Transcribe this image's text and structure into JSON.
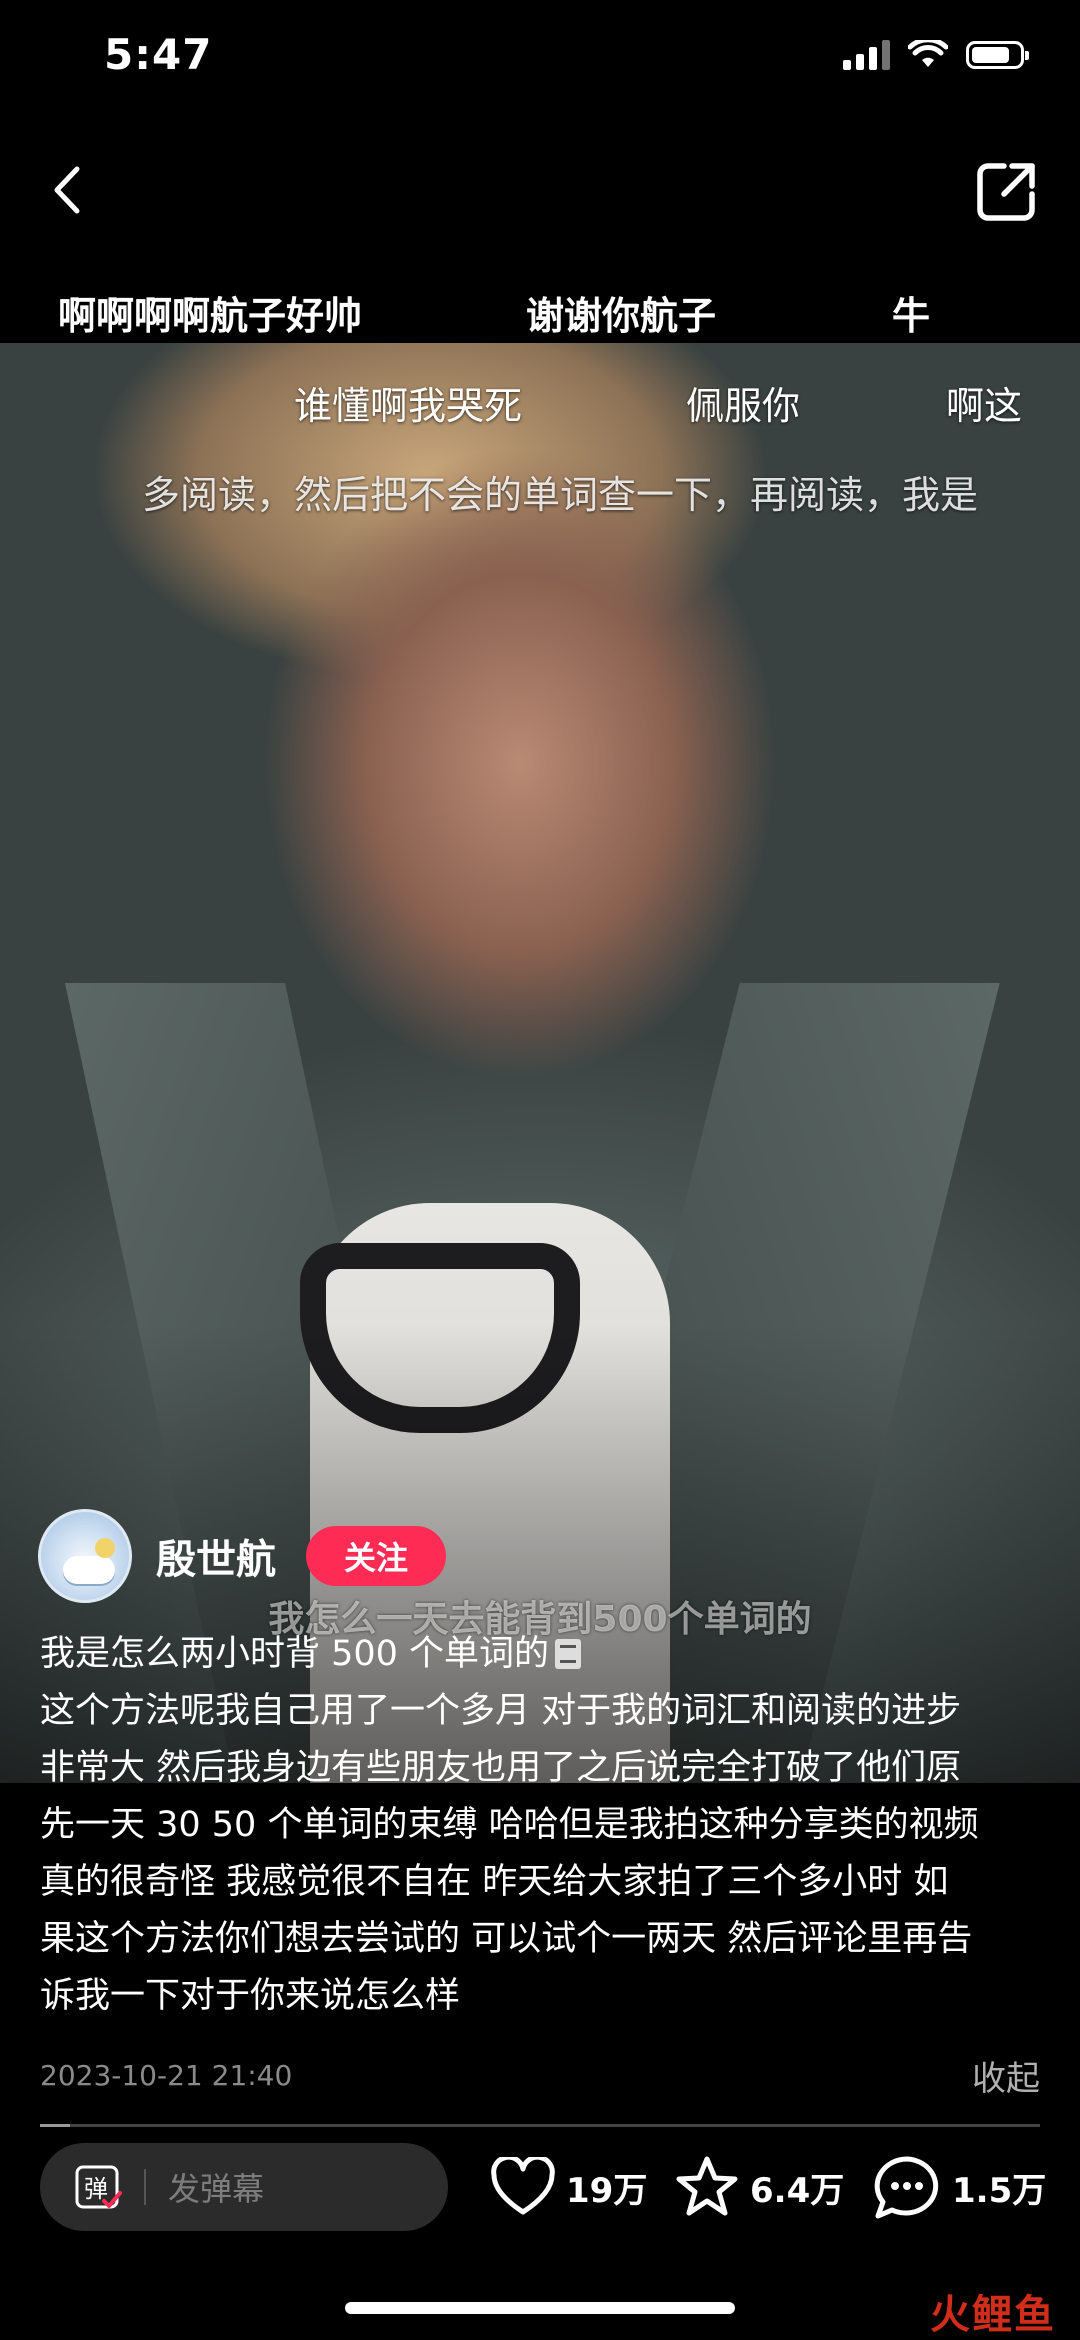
{
  "status_bar": {
    "time": "5:47",
    "battery_level": 0.8
  },
  "nav": {
    "back_icon": "chevron-left-icon",
    "share_icon": "share-external-icon"
  },
  "danmaku": [
    {
      "text": "啊啊啊啊航子好帅"
    },
    {
      "text": "谢谢你航子"
    },
    {
      "text": "牛"
    },
    {
      "text": "谁懂啊我哭死"
    },
    {
      "text": "佩服你"
    },
    {
      "text": "啊这"
    },
    {
      "text": "多阅读，然后把不会的单词查一下，再阅读，我是"
    }
  ],
  "video": {
    "subtitle": "我怎么一天去能背到500个单词的"
  },
  "author": {
    "name": "殷世航",
    "follow_label": "关注"
  },
  "caption": {
    "title": "我是怎么两小时背 500 个单词的",
    "body_lines": [
      "这个方法呢我自己用了一个多月 对于我的词汇和阅读的进步",
      "非常大 然后我身边有些朋友也用了之后说完全打破了他们原",
      "先一天 30 50 个单词的束缚 哈哈但是我拍这种分享类的视频",
      "真的很奇怪 我感觉很不自在 昨天给大家拍了三个多小时 如",
      "果这个方法你们想去尝试的 可以试个一两天 然后评论里再告",
      "诉我一下对于你来说怎么样"
    ]
  },
  "meta": {
    "date": "2023-10-21 21:40",
    "collapse_label": "收起"
  },
  "playback": {
    "progress": 0.03
  },
  "bottom_bar": {
    "danmaku_icon_label": "弹",
    "danmaku_placeholder": "发弹幕",
    "likes": "19万",
    "favorites": "6.4万",
    "comments": "1.5万"
  },
  "watermark": "火鲤鱼",
  "colors": {
    "follow": "#fe2c55",
    "background": "#000000"
  }
}
